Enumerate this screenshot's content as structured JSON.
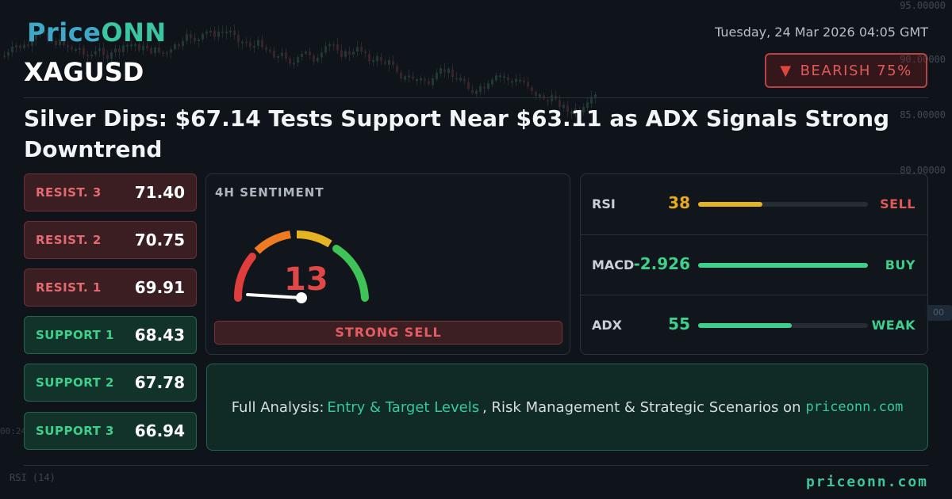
{
  "brand": {
    "logo_part1": "Price",
    "logo_part2": "ONN",
    "footer_site": "priceonn.com"
  },
  "header": {
    "symbol": "XAGUSD",
    "datetime": "Tuesday, 24 Mar 2026 04:05 GMT",
    "bias_label": "BEARISH 75%",
    "bias_icon": "down-triangle-icon",
    "headline": "Silver Dips: $67.14 Tests Support Near $63.11 as ADX Signals Strong Downtrend"
  },
  "levels": [
    {
      "name": "RESIST. 3",
      "value": "71.40",
      "kind": "resistance"
    },
    {
      "name": "RESIST. 2",
      "value": "70.75",
      "kind": "resistance"
    },
    {
      "name": "RESIST. 1",
      "value": "69.91",
      "kind": "resistance"
    },
    {
      "name": "SUPPORT 1",
      "value": "68.43",
      "kind": "support"
    },
    {
      "name": "SUPPORT 2",
      "value": "67.78",
      "kind": "support"
    },
    {
      "name": "SUPPORT 3",
      "value": "66.94",
      "kind": "support"
    }
  ],
  "sentiment": {
    "title": "4H SENTIMENT",
    "value": "13",
    "gauge_fraction": 0.13,
    "label": "STRONG SELL"
  },
  "indicators": [
    {
      "name": "RSI",
      "value": "38",
      "signal": "SELL",
      "bar_fraction": 0.38,
      "value_color": "#e6a922",
      "bar_color": "#e6b423",
      "signal_color": "#e05a5a"
    },
    {
      "name": "MACD",
      "value": "-2.926",
      "signal": "BUY",
      "bar_fraction": 1.0,
      "value_color": "#3ed08a",
      "bar_color": "#3ed08a",
      "signal_color": "#3ed08a"
    },
    {
      "name": "ADX",
      "value": "55",
      "signal": "WEAK",
      "bar_fraction": 0.55,
      "value_color": "#3ed08a",
      "bar_color": "#3ed08a",
      "signal_color": "#3ed08a"
    }
  ],
  "cta": {
    "prefix": "Full Analysis:",
    "highlight": "Entry & Target Levels",
    "middle": ", Risk Management & Strategic Scenarios on",
    "site": "priceonn.com"
  },
  "background": {
    "price_labels": [
      "95.00000",
      "90.00000",
      "85.00000",
      "80.00000"
    ],
    "rsi_label": "RSI (14)",
    "time_label": "00:24",
    "tag": "00"
  },
  "colors": {
    "accent": "#38c7a0",
    "bearish": "#e05a5a",
    "bullish": "#3ed08a"
  }
}
